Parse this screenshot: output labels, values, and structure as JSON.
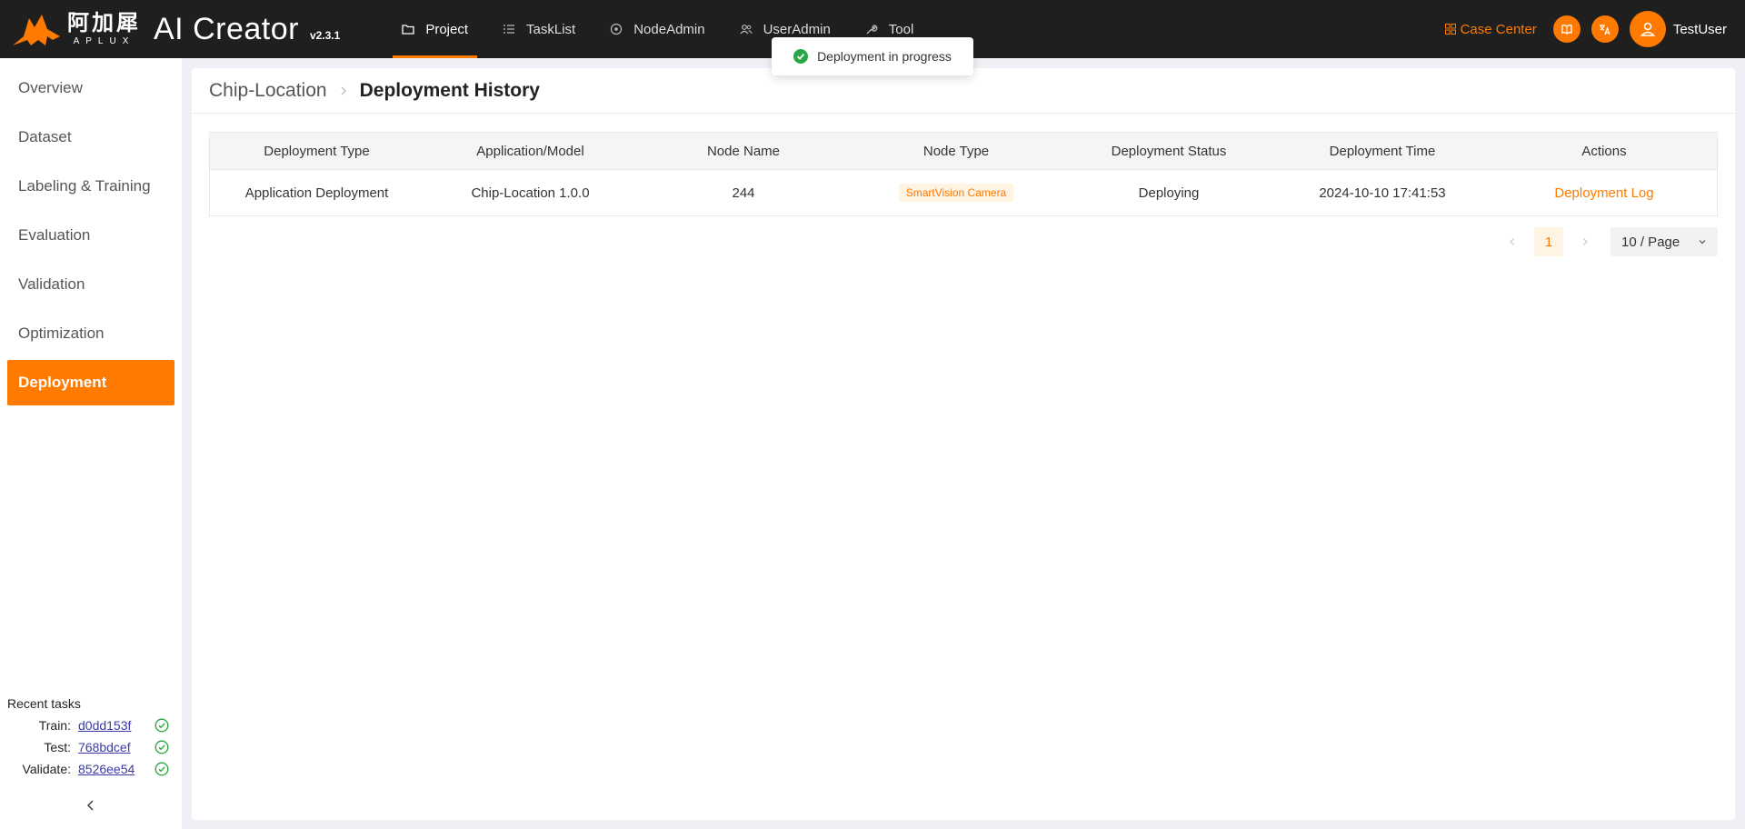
{
  "brand": {
    "logo_cn": "阿加犀",
    "logo_en": "APLUX",
    "app_name": "AI Creator",
    "version": "v2.3.1"
  },
  "nav": {
    "items": [
      {
        "label": "Project",
        "icon": "folder-icon"
      },
      {
        "label": "TaskList",
        "icon": "tasklist-icon"
      },
      {
        "label": "NodeAdmin",
        "icon": "node-icon"
      },
      {
        "label": "UserAdmin",
        "icon": "users-icon"
      },
      {
        "label": "Tool",
        "icon": "wrench-icon"
      }
    ],
    "active": "Project"
  },
  "top_right": {
    "case_center": "Case Center",
    "username": "TestUser"
  },
  "toast": {
    "message": "Deployment in progress"
  },
  "sidebar": {
    "items": [
      {
        "label": "Overview"
      },
      {
        "label": "Dataset"
      },
      {
        "label": "Labeling & Training"
      },
      {
        "label": "Evaluation"
      },
      {
        "label": "Validation"
      },
      {
        "label": "Optimization"
      },
      {
        "label": "Deployment"
      }
    ],
    "active": "Deployment",
    "recent": {
      "title": "Recent tasks",
      "tasks": [
        {
          "label": "Train:",
          "id": "d0dd153f"
        },
        {
          "label": "Test:",
          "id": "768bdcef"
        },
        {
          "label": "Validate:",
          "id": "8526ee54"
        }
      ]
    }
  },
  "breadcrumb": {
    "parent": "Chip-Location",
    "current": "Deployment History"
  },
  "table": {
    "headers": [
      "Deployment Type",
      "Application/Model",
      "Node Name",
      "Node Type",
      "Deployment Status",
      "Deployment Time",
      "Actions"
    ],
    "rows": [
      {
        "type": "Application Deployment",
        "model": "Chip-Location 1.0.0",
        "node_name": "244",
        "node_type": "SmartVision Camera",
        "status": "Deploying",
        "time": "2024-10-10 17:41:53",
        "action": "Deployment Log"
      }
    ]
  },
  "pagination": {
    "current_page": "1",
    "page_size": "10 / Page"
  },
  "colors": {
    "accent": "#ff7a00",
    "topbar": "#1f1f1f",
    "success": "#27a844"
  }
}
